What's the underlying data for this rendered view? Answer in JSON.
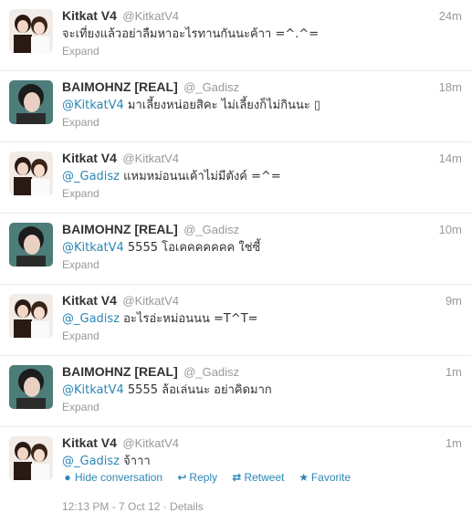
{
  "tweets": [
    {
      "name": "Kitkat V4",
      "handle": "@KitkatV4",
      "time": "24m",
      "mention": "",
      "text": "จะเที่ยงแล้วอย่าลืมหาอะไรทานกันนะค้าา =^.^=",
      "expand": "Expand",
      "avatar_icon": "kitkat-avatar-icon"
    },
    {
      "name": "BAIMOHNZ [REAL]",
      "handle": "@_Gadisz",
      "time": "18m",
      "mention": "@KitkatV4",
      "text": " มาเลี้ยงหน่อยสิคะ ไม่เลี้ยงก็ไม่กินนะ ▯",
      "expand": "Expand",
      "avatar_icon": "baimohnz-avatar-icon"
    },
    {
      "name": "Kitkat V4",
      "handle": "@KitkatV4",
      "time": "14m",
      "mention": "@_Gadisz",
      "text": " แหมหม่อนนเค้าไม่มีตังค์ =^=",
      "expand": "Expand",
      "avatar_icon": "kitkat-avatar-icon"
    },
    {
      "name": "BAIMOHNZ [REAL]",
      "handle": "@_Gadisz",
      "time": "10m",
      "mention": "@KitkatV4",
      "text": " 5555 โอเคคคคคคค ใช่ซี้",
      "expand": "Expand",
      "avatar_icon": "baimohnz-avatar-icon"
    },
    {
      "name": "Kitkat V4",
      "handle": "@KitkatV4",
      "time": "9m",
      "mention": "@_Gadisz",
      "text": " อะไรอ่ะหม่อนนน =T^T=",
      "expand": "Expand",
      "avatar_icon": "kitkat-avatar-icon"
    },
    {
      "name": "BAIMOHNZ [REAL]",
      "handle": "@_Gadisz",
      "time": "1m",
      "mention": "@KitkatV4",
      "text": " 5555 ล้อเล่นนะ อย่าคิดมาก",
      "expand": "Expand",
      "avatar_icon": "baimohnz-avatar-icon"
    },
    {
      "name": "Kitkat V4",
      "handle": "@KitkatV4",
      "time": "1m",
      "mention": "@_Gadisz",
      "text": " จ้าาา",
      "avatar_icon": "kitkat-avatar-icon",
      "actions": {
        "hide_conversation": "Hide conversation",
        "reply": "Reply",
        "retweet": "Retweet",
        "favorite": "Favorite"
      },
      "meta": "12:13 PM - 7 Oct 12 · Details"
    }
  ],
  "colors": {
    "link": "#2c86b5",
    "muted": "#999999",
    "text": "#333333",
    "divider": "#e8e8e8"
  }
}
